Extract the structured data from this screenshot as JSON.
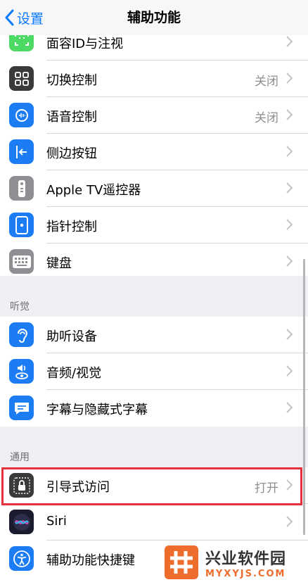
{
  "nav": {
    "back_label": "设置",
    "title": "辅助功能"
  },
  "group1": [
    {
      "key": "face",
      "label": "面容ID与注视",
      "value": "",
      "color": "#4cd964"
    },
    {
      "key": "switch",
      "label": "切换控制",
      "value": "关闭",
      "color": "#3a3a3c"
    },
    {
      "key": "voice",
      "label": "语音控制",
      "value": "关闭",
      "color": "#1c7cf4"
    },
    {
      "key": "side",
      "label": "侧边按钮",
      "value": "",
      "color": "#1c7cf4"
    },
    {
      "key": "appletv",
      "label": "Apple TV遥控器",
      "value": "",
      "color": "#8e8e93"
    },
    {
      "key": "pointer",
      "label": "指针控制",
      "value": "",
      "color": "#1c7cf4"
    },
    {
      "key": "keyboard",
      "label": "键盘",
      "value": "",
      "color": "#8e8e93"
    }
  ],
  "section_hearing": "听觉",
  "group2": [
    {
      "key": "hearing",
      "label": "助听设备",
      "value": "",
      "color": "#1c7cf4"
    },
    {
      "key": "audio",
      "label": "音频/视觉",
      "value": "",
      "color": "#1c7cf4"
    },
    {
      "key": "subtitles",
      "label": "字幕与隐藏式字幕",
      "value": "",
      "color": "#1c7cf4"
    }
  ],
  "section_general": "通用",
  "group3": [
    {
      "key": "guided",
      "label": "引导式访问",
      "value": "打开",
      "color": "#3a3a3c"
    },
    {
      "key": "siri",
      "label": "Siri",
      "value": "",
      "color": "#222"
    },
    {
      "key": "shortcut",
      "label": "辅助功能快捷键",
      "value": "",
      "color": "#1c7cf4"
    }
  ],
  "watermark": {
    "cn": "兴业软件园",
    "en": "MYXYJS.COM"
  },
  "accent_color": "#0a7aff",
  "highlight_color": "#e8303c"
}
